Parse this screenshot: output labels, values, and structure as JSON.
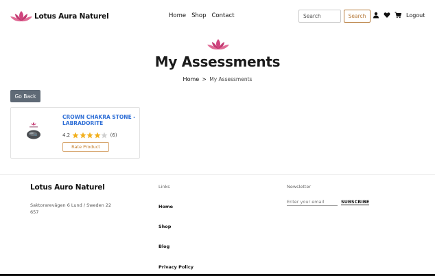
{
  "header": {
    "brand": "Lotus Aura Naturel",
    "nav": [
      "Home",
      "Shop",
      "Contact"
    ],
    "search_placeholder": "Search",
    "search_button": "Search",
    "logout": "Logout"
  },
  "page": {
    "title": "My Assessments",
    "breadcrumb_home": "Home",
    "breadcrumb_sep": ">",
    "breadcrumb_current": "My Assessments",
    "go_back": "Go Back"
  },
  "product": {
    "name": "CROWN CHAKRA STONE - LABRADORITE",
    "rating": "4.2",
    "rating_value": 4.2,
    "rating_max": 5,
    "review_count": "(6)",
    "rate_button": "Rate Product"
  },
  "footer": {
    "brand": "Lotus Auro Naturel",
    "address": "Saktorarevägen 6 Lund / Sweden 22 657",
    "links_title": "Links",
    "links": [
      "Home",
      "Shop",
      "Blog",
      "Privacy Policy"
    ],
    "newsletter_title": "Newsletter",
    "email_placeholder": "Enter your email",
    "subscribe": "SUBSCRIBE"
  },
  "colors": {
    "accent": "#b67a3a",
    "link_blue": "#2f6fd6",
    "star_filled": "#f2b01e",
    "star_empty": "#d0d0d0",
    "go_back_bg": "#5f6a76",
    "lotus_pink": "#d0457e"
  },
  "icons": [
    "lotus-logo-icon",
    "user-icon",
    "heart-icon",
    "cart-icon",
    "star-icon"
  ]
}
